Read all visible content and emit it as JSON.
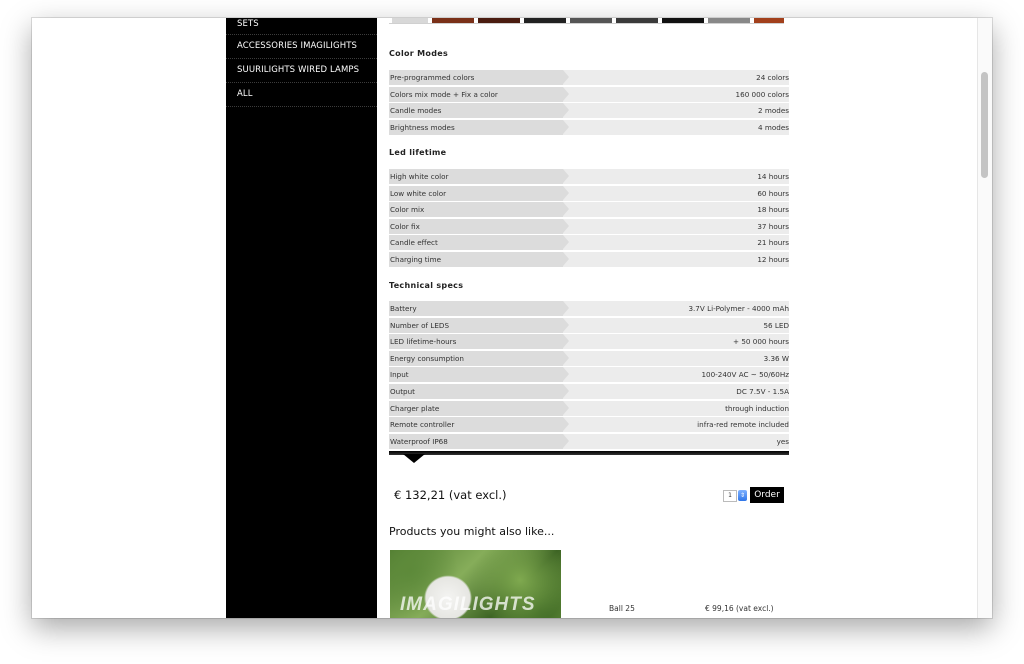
{
  "sidebar": {
    "items": [
      {
        "label": "SETS"
      },
      {
        "label": "ACCESSORIES IMAGILIGHTS"
      },
      {
        "label": "SUURILIGHTS WIRED LAMPS"
      },
      {
        "label": "ALL"
      }
    ]
  },
  "specs": {
    "color_modes": {
      "title": "Color Modes",
      "rows": [
        {
          "label": "Pre-programmed colors",
          "value": "24 colors"
        },
        {
          "label": "Colors mix mode + Fix a color",
          "value": "160 000 colors"
        },
        {
          "label": "Candle modes",
          "value": "2 modes"
        },
        {
          "label": "Brightness modes",
          "value": "4 modes"
        }
      ]
    },
    "led_lifetime": {
      "title": "Led lifetime",
      "rows": [
        {
          "label": "High white color",
          "value": "14 hours"
        },
        {
          "label": "Low white color",
          "value": "60 hours"
        },
        {
          "label": "Color mix",
          "value": "18 hours"
        },
        {
          "label": "Color fix",
          "value": "37 hours"
        },
        {
          "label": "Candle effect",
          "value": "21 hours"
        },
        {
          "label": "Charging time",
          "value": "12 hours"
        }
      ]
    },
    "technical": {
      "title": "Technical specs",
      "rows": [
        {
          "label": "Battery",
          "value": "3.7V Li-Polymer - 4000 mAh"
        },
        {
          "label": "Number of LEDS",
          "value": "56 LED"
        },
        {
          "label": "LED lifetime-hours",
          "value": "+ 50 000 hours"
        },
        {
          "label": "Energy consumption",
          "value": "3.36 W"
        },
        {
          "label": "Input",
          "value": "100-240V AC ~ 50/60Hz"
        },
        {
          "label": "Output",
          "value": "DC 7.5V - 1.5A"
        },
        {
          "label": "Charger plate",
          "value": "through induction"
        },
        {
          "label": "Remote controller",
          "value": "infra-red remote included"
        },
        {
          "label": "Waterproof IP68",
          "value": "yes"
        }
      ]
    }
  },
  "order": {
    "price": "€ 132,21 (vat excl.)",
    "quantity": "1",
    "button_label": "Order"
  },
  "related": {
    "title": "Products you might also like...",
    "items": [
      {
        "watermark": "IMAGILIGHTS",
        "name": "Ball 25",
        "price": "€ 99,16 (vat excl.)"
      }
    ]
  },
  "colors": {
    "sidebar_bg": "#000000",
    "row_bg": "#ececec",
    "row_label_bg": "#dcdcdc",
    "spinner_accent": "#2f76e8"
  },
  "icons": {
    "quantity_spinner": "spinner-icon"
  }
}
